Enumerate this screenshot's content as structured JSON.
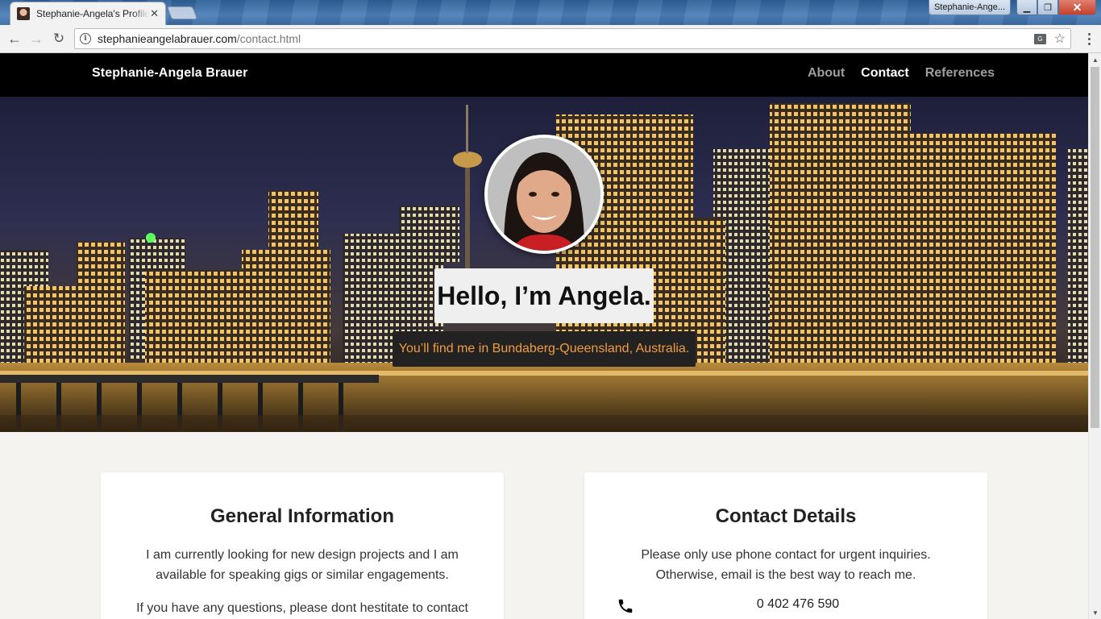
{
  "browser": {
    "tab_title": "Stephanie-Angela's Profile",
    "profile_name": "Stephanie-Ange...",
    "url_host": "stephanieangelabrauer.com",
    "url_path": "/contact.html"
  },
  "nav": {
    "brand": "Stephanie-Angela Brauer",
    "links": [
      {
        "label": "About",
        "active": false
      },
      {
        "label": "Contact",
        "active": true
      },
      {
        "label": "References",
        "active": false
      }
    ]
  },
  "hero": {
    "heading": "Hello, I’m Angela.",
    "location": "You’ll find me in Bundaberg-Queensland, Australia."
  },
  "general": {
    "title": "General Information",
    "paragraph1": "I am currently looking for new design projects and I am available for speaking gigs or similar engagements.",
    "paragraph2": "If you have any questions, please dont hestitate to contact"
  },
  "contact": {
    "title": "Contact Details",
    "intro": "Please only use phone contact for urgent inquiries. Otherwise, email is the best way to reach me.",
    "phone": "0 402 476 590"
  },
  "colors": {
    "nav_bg": "#000000",
    "accent_orange": "#f39c3c",
    "page_bg": "#f4f3ef"
  }
}
